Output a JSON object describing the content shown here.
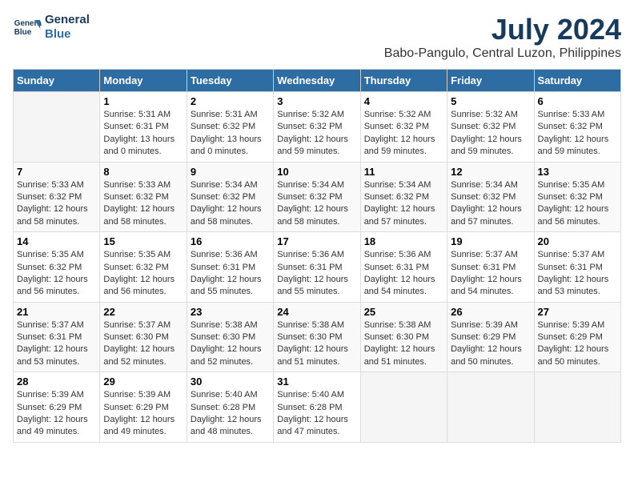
{
  "header": {
    "logo_line1": "General",
    "logo_line2": "Blue",
    "title": "July 2024",
    "subtitle": "Babo-Pangulo, Central Luzon, Philippines"
  },
  "columns": [
    "Sunday",
    "Monday",
    "Tuesday",
    "Wednesday",
    "Thursday",
    "Friday",
    "Saturday"
  ],
  "weeks": [
    [
      {
        "day": "",
        "info": ""
      },
      {
        "day": "1",
        "info": "Sunrise: 5:31 AM\nSunset: 6:31 PM\nDaylight: 13 hours\nand 0 minutes."
      },
      {
        "day": "2",
        "info": "Sunrise: 5:31 AM\nSunset: 6:32 PM\nDaylight: 13 hours\nand 0 minutes."
      },
      {
        "day": "3",
        "info": "Sunrise: 5:32 AM\nSunset: 6:32 PM\nDaylight: 12 hours\nand 59 minutes."
      },
      {
        "day": "4",
        "info": "Sunrise: 5:32 AM\nSunset: 6:32 PM\nDaylight: 12 hours\nand 59 minutes."
      },
      {
        "day": "5",
        "info": "Sunrise: 5:32 AM\nSunset: 6:32 PM\nDaylight: 12 hours\nand 59 minutes."
      },
      {
        "day": "6",
        "info": "Sunrise: 5:33 AM\nSunset: 6:32 PM\nDaylight: 12 hours\nand 59 minutes."
      }
    ],
    [
      {
        "day": "7",
        "info": "Sunrise: 5:33 AM\nSunset: 6:32 PM\nDaylight: 12 hours\nand 58 minutes."
      },
      {
        "day": "8",
        "info": "Sunrise: 5:33 AM\nSunset: 6:32 PM\nDaylight: 12 hours\nand 58 minutes."
      },
      {
        "day": "9",
        "info": "Sunrise: 5:34 AM\nSunset: 6:32 PM\nDaylight: 12 hours\nand 58 minutes."
      },
      {
        "day": "10",
        "info": "Sunrise: 5:34 AM\nSunset: 6:32 PM\nDaylight: 12 hours\nand 58 minutes."
      },
      {
        "day": "11",
        "info": "Sunrise: 5:34 AM\nSunset: 6:32 PM\nDaylight: 12 hours\nand 57 minutes."
      },
      {
        "day": "12",
        "info": "Sunrise: 5:34 AM\nSunset: 6:32 PM\nDaylight: 12 hours\nand 57 minutes."
      },
      {
        "day": "13",
        "info": "Sunrise: 5:35 AM\nSunset: 6:32 PM\nDaylight: 12 hours\nand 56 minutes."
      }
    ],
    [
      {
        "day": "14",
        "info": "Sunrise: 5:35 AM\nSunset: 6:32 PM\nDaylight: 12 hours\nand 56 minutes."
      },
      {
        "day": "15",
        "info": "Sunrise: 5:35 AM\nSunset: 6:32 PM\nDaylight: 12 hours\nand 56 minutes."
      },
      {
        "day": "16",
        "info": "Sunrise: 5:36 AM\nSunset: 6:31 PM\nDaylight: 12 hours\nand 55 minutes."
      },
      {
        "day": "17",
        "info": "Sunrise: 5:36 AM\nSunset: 6:31 PM\nDaylight: 12 hours\nand 55 minutes."
      },
      {
        "day": "18",
        "info": "Sunrise: 5:36 AM\nSunset: 6:31 PM\nDaylight: 12 hours\nand 54 minutes."
      },
      {
        "day": "19",
        "info": "Sunrise: 5:37 AM\nSunset: 6:31 PM\nDaylight: 12 hours\nand 54 minutes."
      },
      {
        "day": "20",
        "info": "Sunrise: 5:37 AM\nSunset: 6:31 PM\nDaylight: 12 hours\nand 53 minutes."
      }
    ],
    [
      {
        "day": "21",
        "info": "Sunrise: 5:37 AM\nSunset: 6:31 PM\nDaylight: 12 hours\nand 53 minutes."
      },
      {
        "day": "22",
        "info": "Sunrise: 5:37 AM\nSunset: 6:30 PM\nDaylight: 12 hours\nand 52 minutes."
      },
      {
        "day": "23",
        "info": "Sunrise: 5:38 AM\nSunset: 6:30 PM\nDaylight: 12 hours\nand 52 minutes."
      },
      {
        "day": "24",
        "info": "Sunrise: 5:38 AM\nSunset: 6:30 PM\nDaylight: 12 hours\nand 51 minutes."
      },
      {
        "day": "25",
        "info": "Sunrise: 5:38 AM\nSunset: 6:30 PM\nDaylight: 12 hours\nand 51 minutes."
      },
      {
        "day": "26",
        "info": "Sunrise: 5:39 AM\nSunset: 6:29 PM\nDaylight: 12 hours\nand 50 minutes."
      },
      {
        "day": "27",
        "info": "Sunrise: 5:39 AM\nSunset: 6:29 PM\nDaylight: 12 hours\nand 50 minutes."
      }
    ],
    [
      {
        "day": "28",
        "info": "Sunrise: 5:39 AM\nSunset: 6:29 PM\nDaylight: 12 hours\nand 49 minutes."
      },
      {
        "day": "29",
        "info": "Sunrise: 5:39 AM\nSunset: 6:29 PM\nDaylight: 12 hours\nand 49 minutes."
      },
      {
        "day": "30",
        "info": "Sunrise: 5:40 AM\nSunset: 6:28 PM\nDaylight: 12 hours\nand 48 minutes."
      },
      {
        "day": "31",
        "info": "Sunrise: 5:40 AM\nSunset: 6:28 PM\nDaylight: 12 hours\nand 47 minutes."
      },
      {
        "day": "",
        "info": ""
      },
      {
        "day": "",
        "info": ""
      },
      {
        "day": "",
        "info": ""
      }
    ]
  ]
}
